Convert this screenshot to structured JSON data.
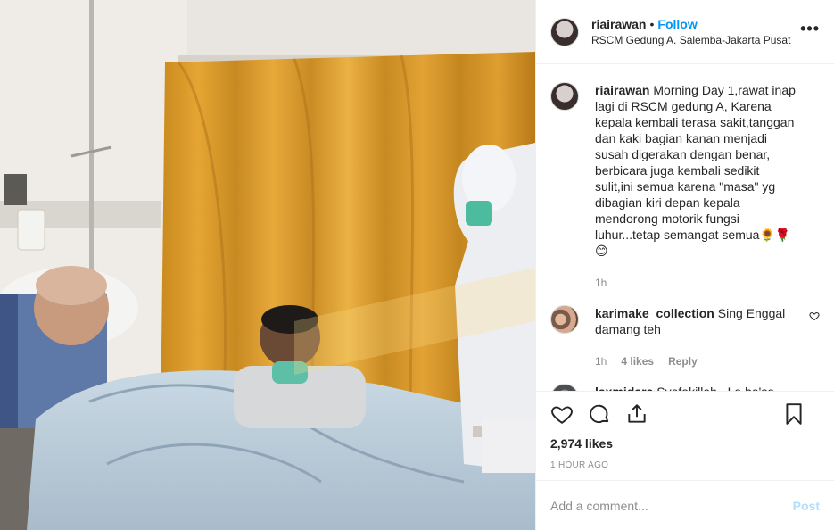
{
  "post": {
    "username": "riairawan",
    "separator": "•",
    "follow_label": "Follow",
    "location": "RSCM Gedung A. Salemba-Jakarta Pusat",
    "more_label": "•••"
  },
  "caption": {
    "username": "riairawan",
    "text": "Morning Day 1,rawat inap lagi di RSCM gedung A, Karena kepala kembali terasa sakit,tanggan dan kaki bagian kanan menjadi susah digerakan dengan benar, berbicara juga kembali sedikit sulit,ini semua karena \"masa\" yg dibagian kiri depan kepala mendorong motorik fungsi luhur...tetap semangat semua🌻🌹😊",
    "time": "1h"
  },
  "comments": [
    {
      "username": "karimake_collection",
      "text": "Sing Enggal damang teh",
      "time": "1h",
      "likes": "4 likes",
      "reply": "Reply"
    },
    {
      "username": "laxmidara",
      "text": "Syafakillah.. La ba'sa Thohurun In syaa Allah.. Aamiin",
      "time": "",
      "likes": "",
      "reply": ""
    }
  ],
  "stats": {
    "likes": "2,974 likes",
    "timestamp": "1 HOUR AGO"
  },
  "add_comment": {
    "placeholder": "Add a comment...",
    "post_label": "Post"
  },
  "icons": [
    "heart-icon",
    "comment-icon",
    "share-icon",
    "bookmark-icon"
  ],
  "colors": {
    "accent": "#0095f6",
    "post_disabled": "#b2dffc",
    "muted": "#8e8e8e"
  }
}
